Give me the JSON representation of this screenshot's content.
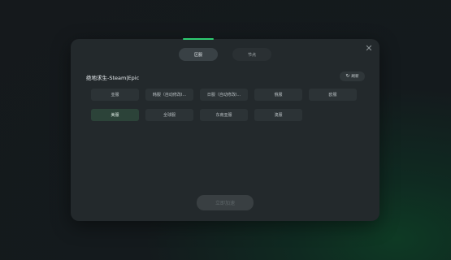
{
  "tabs": [
    {
      "label": "区服",
      "active": true
    },
    {
      "label": "节点",
      "active": false
    }
  ],
  "game_title": "绝地求生-Steam|Epic",
  "refresh_label": "刷新",
  "close_symbol": "✕",
  "refresh_icon": "↻",
  "regions": [
    {
      "label": "亚服",
      "selected": false
    },
    {
      "label": "韩服（自动修改I...",
      "selected": false
    },
    {
      "label": "日服（自动修改I...",
      "selected": false
    },
    {
      "label": "俄服",
      "selected": false
    },
    {
      "label": "欧服",
      "selected": false
    },
    {
      "label": "美服",
      "selected": true
    },
    {
      "label": "全球服",
      "selected": false
    },
    {
      "label": "东南亚服",
      "selected": false
    },
    {
      "label": "澳服",
      "selected": false
    }
  ],
  "accelerate_label": "立即加速",
  "colors": {
    "accent_green": "#2ecc71",
    "dialog_bg": "#23292c",
    "selected_bg": "#2c4339"
  }
}
